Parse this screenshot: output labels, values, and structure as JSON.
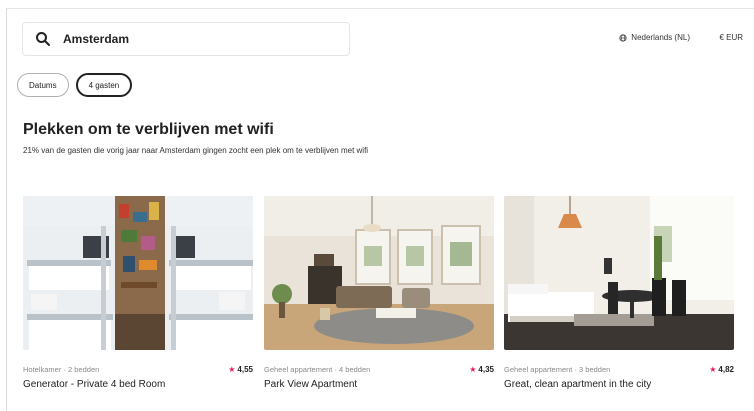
{
  "search": {
    "value": "Amsterdam",
    "icon": "search-icon"
  },
  "header": {
    "language": "Nederlands (NL)",
    "language_icon": "globe-icon",
    "currency": "€ EUR"
  },
  "filters": [
    {
      "label": "Datums",
      "active": false
    },
    {
      "label": "4 gasten",
      "active": true
    }
  ],
  "section": {
    "title": "Plekken om te verblijven met wifi",
    "subtitle": "21% van de gasten die vorig jaar naar Amsterdam gingen zocht een plek om te verblijven met wifi"
  },
  "listings": [
    {
      "type": "Hotelkamer · 2 bedden",
      "rating": "4,55",
      "name": "Generator - Private 4 bed Room"
    },
    {
      "type": "Geheel appartement · 4 bedden",
      "rating": "4,35",
      "name": "Park View Apartment"
    },
    {
      "type": "Geheel appartement · 3 bedden",
      "rating": "4,82",
      "name": "Great, clean apartment in the city"
    }
  ],
  "colors": {
    "accent": "#e31c5f",
    "text": "#222222",
    "muted": "#8a8a8a",
    "border": "#dddddd"
  }
}
